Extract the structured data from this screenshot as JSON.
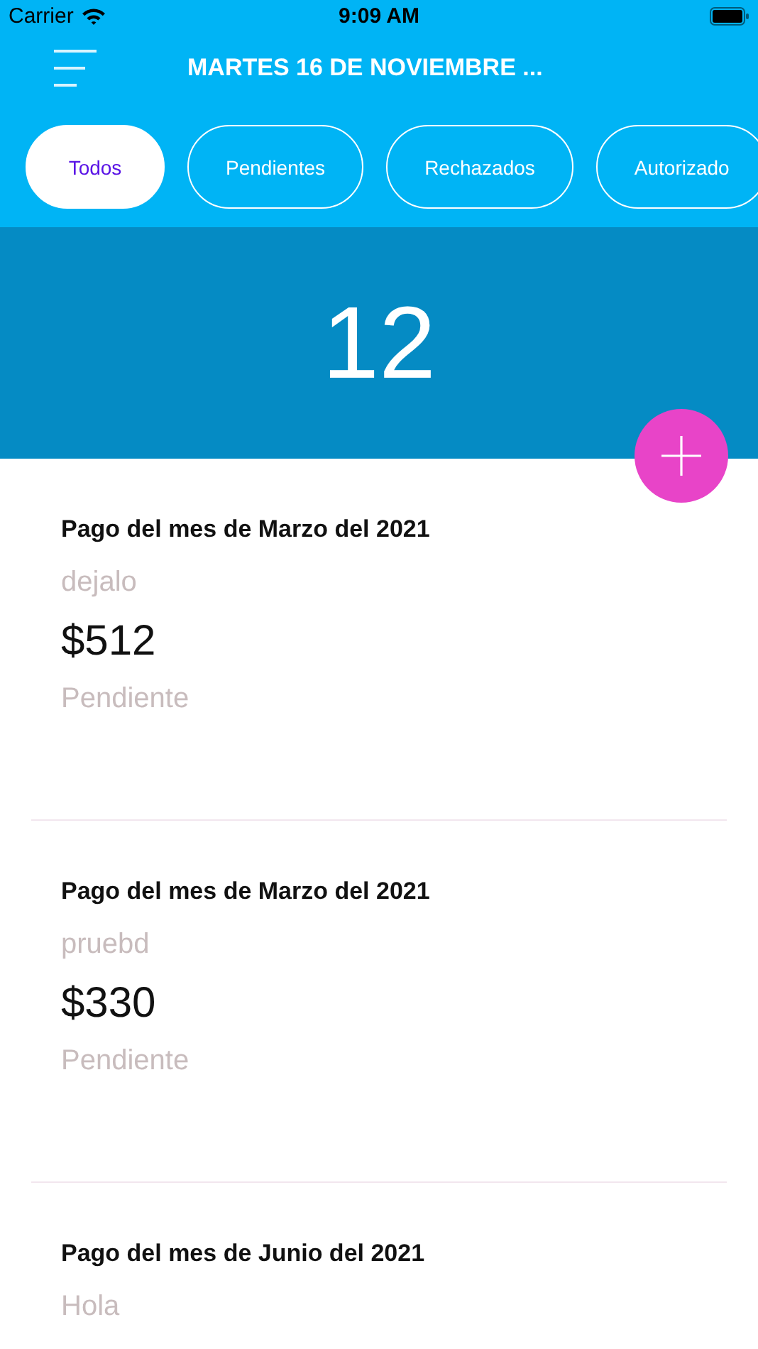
{
  "status_bar": {
    "carrier": "Carrier",
    "time": "9:09 AM"
  },
  "header": {
    "title": "MARTES 16 DE NOVIEMBRE ..."
  },
  "tabs": [
    {
      "label": "Todos",
      "selected": true
    },
    {
      "label": "Pendientes",
      "selected": false
    },
    {
      "label": "Rechazados",
      "selected": false
    },
    {
      "label": "Autorizado",
      "selected": false
    }
  ],
  "count": "12",
  "payments": [
    {
      "title": "Pago del mes de Marzo del 2021",
      "description": "dejalo",
      "amount": "$512",
      "status": "Pendiente"
    },
    {
      "title": "Pago del mes de Marzo del 2021",
      "description": "pruebd",
      "amount": "$330",
      "status": "Pendiente"
    },
    {
      "title": "Pago del mes de Junio del 2021",
      "description": "Hola"
    }
  ]
}
